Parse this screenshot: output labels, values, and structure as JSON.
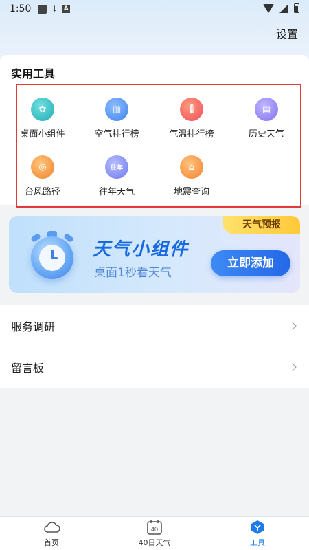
{
  "status": {
    "time": "1:50",
    "icons": [
      "image-icon",
      "download-icon",
      "a-icon"
    ],
    "right_icons": [
      "wifi-icon",
      "signal-icon",
      "battery-icon"
    ]
  },
  "header": {
    "settings_label": "设置"
  },
  "tools": {
    "title": "实用工具",
    "items": [
      {
        "label": "桌面小组件",
        "icon": "puzzle-icon",
        "color": "#2fbfc4"
      },
      {
        "label": "空气排行榜",
        "icon": "bar-chart-icon",
        "color": "#4a8ef0"
      },
      {
        "label": "气温排行榜",
        "icon": "thermometer-icon",
        "color": "#f0574a"
      },
      {
        "label": "历史天气",
        "icon": "calendar-clock-icon",
        "color": "#8b7df2"
      },
      {
        "label": "台风路径",
        "icon": "typhoon-icon",
        "color": "#f59331"
      },
      {
        "label": "往年天气",
        "icon": "past-year-icon",
        "glyph": "往年",
        "color": "#7d86f2"
      },
      {
        "label": "地震查询",
        "icon": "earthquake-icon",
        "color": "#f5913a"
      }
    ]
  },
  "banner": {
    "tag": "天气预报",
    "title": "天气小组件",
    "subtitle": "桌面1秒看天气",
    "button": "立即添加"
  },
  "list": {
    "items": [
      {
        "label": "服务调研"
      },
      {
        "label": "留言板"
      }
    ]
  },
  "tabbar": {
    "tabs": [
      {
        "label": "首页",
        "icon": "cloud-icon",
        "active": false
      },
      {
        "label": "40日天气",
        "icon": "calendar-40-icon",
        "glyph": "40",
        "active": false
      },
      {
        "label": "工具",
        "icon": "tools-hex-icon",
        "active": true
      }
    ],
    "accent": "#1e7be8"
  }
}
